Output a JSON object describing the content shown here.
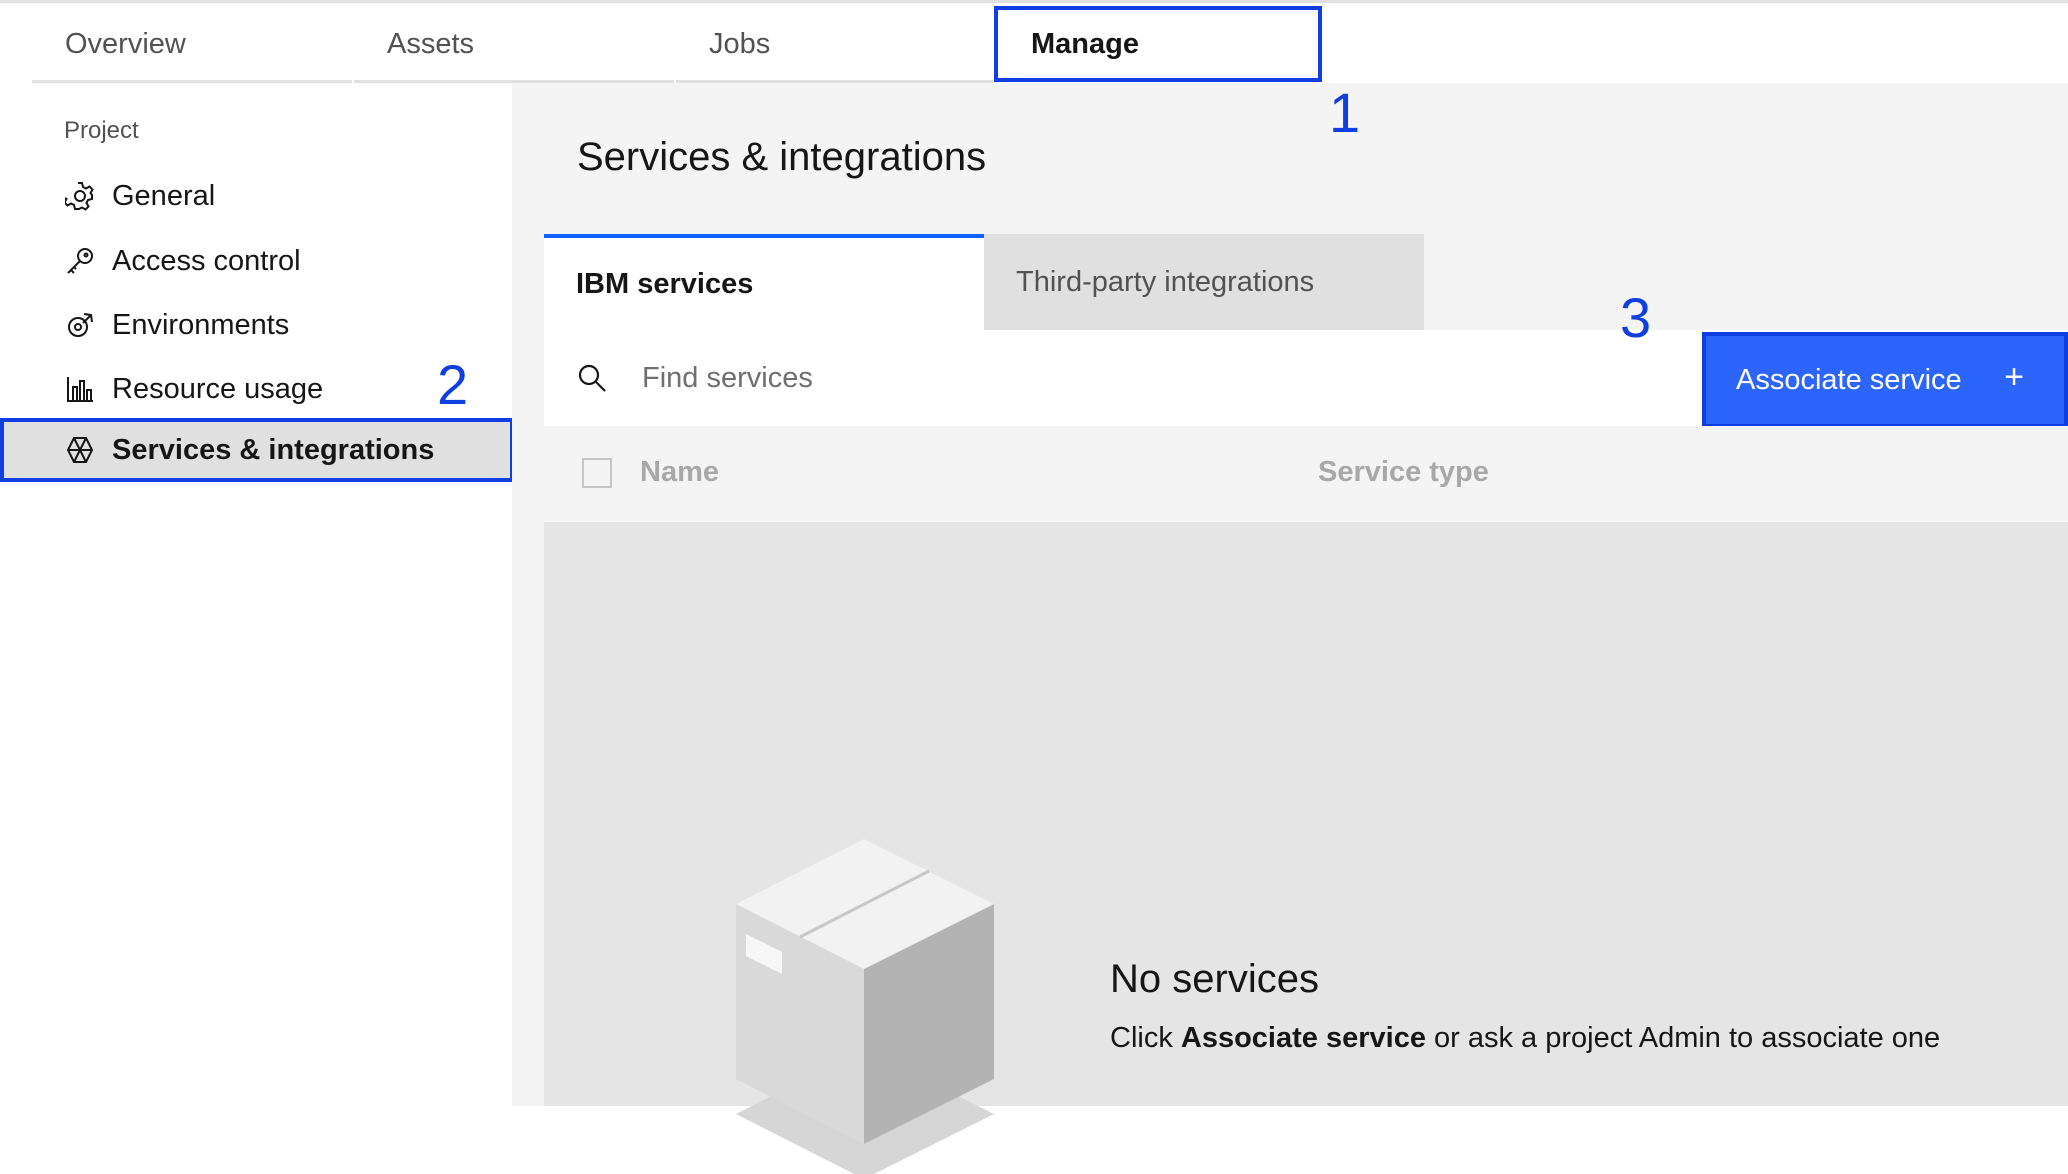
{
  "top_tabs": [
    {
      "label": "Overview"
    },
    {
      "label": "Assets"
    },
    {
      "label": "Jobs"
    },
    {
      "label": "Manage"
    }
  ],
  "sidebar": {
    "heading": "Project",
    "items": [
      {
        "label": "General",
        "icon": "gear-icon"
      },
      {
        "label": "Access control",
        "icon": "key-icon"
      },
      {
        "label": "Environments",
        "icon": "environments-icon"
      },
      {
        "label": "Resource usage",
        "icon": "bar-chart-icon"
      },
      {
        "label": "Services & integrations",
        "icon": "services-icon"
      }
    ]
  },
  "main": {
    "title": "Services & integrations",
    "tabs": [
      {
        "label": "IBM services"
      },
      {
        "label": "Third-party integrations"
      }
    ],
    "search": {
      "placeholder": "Find services"
    },
    "associate_button": {
      "label": "Associate service",
      "icon": "plus"
    },
    "table": {
      "columns": [
        "Name",
        "Service type"
      ]
    },
    "empty_state": {
      "title": "No services",
      "text_before": "Click ",
      "text_bold": "Associate service",
      "text_after": " or ask a project Admin to associate one"
    }
  },
  "annotations": [
    "1",
    "2",
    "3"
  ],
  "colors": {
    "highlight": "#0f3fe0",
    "primary_button": "#2b65fb",
    "tab_accent": "#0f62fe"
  }
}
